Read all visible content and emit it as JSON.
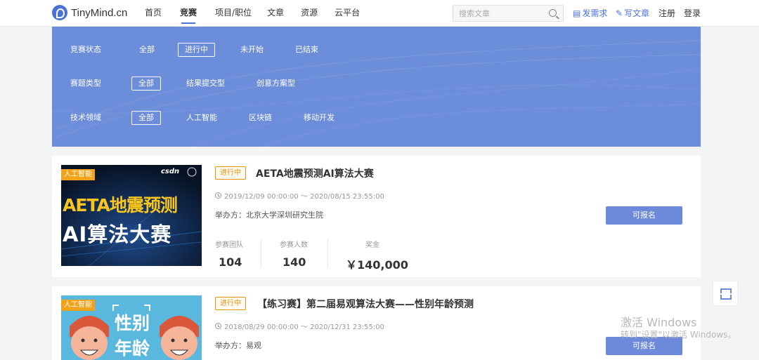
{
  "header": {
    "brand": "TinyMind.cn",
    "nav": [
      "首页",
      "竞赛",
      "项目/职位",
      "文章",
      "资源",
      "云平台"
    ],
    "active_nav": 1,
    "search_placeholder": "搜索文章",
    "post_demand": "发需求",
    "write_article": "写文章",
    "register": "注册",
    "login": "登录"
  },
  "filters": [
    {
      "label": "竞赛状态",
      "options": [
        "全部",
        "进行中",
        "未开始",
        "已结束"
      ],
      "selected": 1
    },
    {
      "label": "赛题类型",
      "options": [
        "全部",
        "结果提交型",
        "创意方案型"
      ],
      "selected": 0
    },
    {
      "label": "技术领域",
      "options": [
        "全部",
        "人工智能",
        "区块链",
        "移动开发"
      ],
      "selected": 0
    }
  ],
  "competitions": [
    {
      "tag": "人工智能",
      "status": "进行中",
      "title": "AETA地震预测AI算法大赛",
      "date": "2019/12/09 00:00:00 ～ 2020/08/15 23:55:00",
      "host": "举办方：北京大学深圳研究生院",
      "button": "可报名",
      "thumb_brand": "csdn",
      "thumb_line1": "AETA地震预测",
      "thumb_line2": "AI算法大赛",
      "stats": [
        {
          "label": "参赛团队",
          "value": "104"
        },
        {
          "label": "参赛人数",
          "value": "140"
        },
        {
          "label": "奖金",
          "value": "￥140,000"
        }
      ]
    },
    {
      "tag": "人工智能",
      "status": "进行中",
      "title": "【练习赛】第二届易观算法大赛——性别年龄预测",
      "date": "2018/08/29 00:00:00 ～ 2020/12/31 23:55:00",
      "host": "举办方：易观",
      "button": "可报名",
      "thumb_line1": "性别",
      "thumb_line2": "年龄"
    }
  ],
  "watermark": {
    "line1": "激活 Windows",
    "line2": "转到\"设置\"以激活 Windows。"
  },
  "colors": {
    "accent": "#4a73d6",
    "banner": "#6c8dd9",
    "status": "#e8920f",
    "tag": "#f2a21b"
  }
}
